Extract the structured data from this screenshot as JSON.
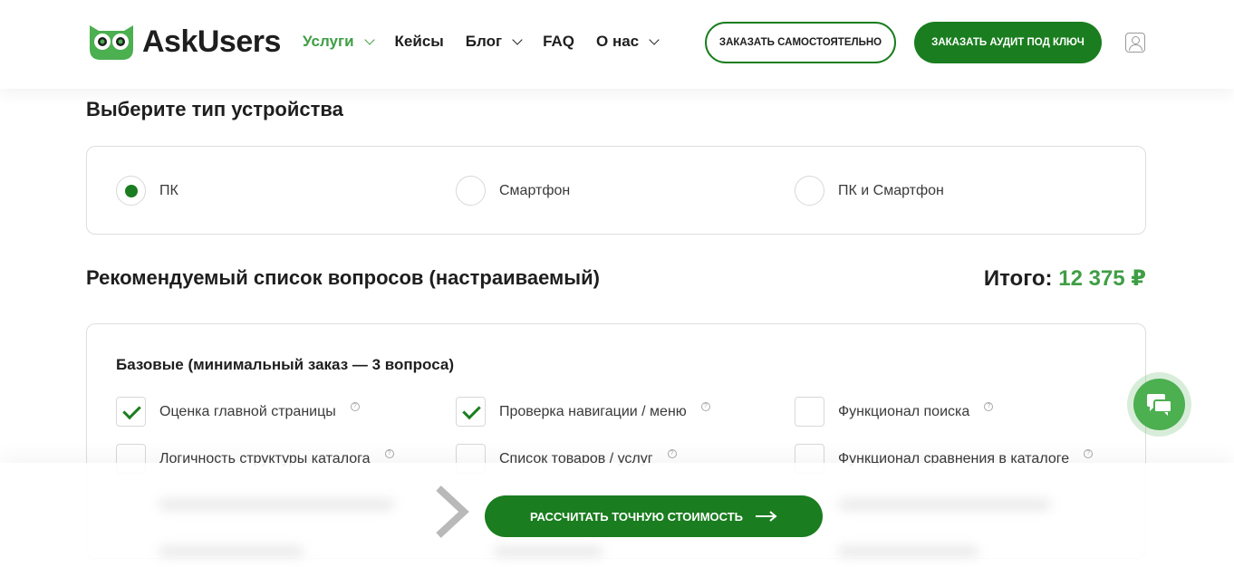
{
  "header": {
    "logo_text": "AskUsers",
    "nav": [
      {
        "label": "Услуги",
        "has_dropdown": true,
        "active": true
      },
      {
        "label": "Кейсы",
        "has_dropdown": false
      },
      {
        "label": "Блог",
        "has_dropdown": true
      },
      {
        "label": "FAQ",
        "has_dropdown": false
      },
      {
        "label": "О нас",
        "has_dropdown": true
      }
    ],
    "btn_self": "ЗАКАЗАТЬ САМОСТОЯТЕЛЬНО",
    "btn_turnkey": "ЗАКАЗАТЬ АУДИТ ПОД КЛЮЧ"
  },
  "device": {
    "title": "Выберите тип устройства",
    "options": [
      {
        "label": "ПК",
        "selected": true
      },
      {
        "label": "Смартфон",
        "selected": false
      },
      {
        "label": "ПК и Смартфон",
        "selected": false
      }
    ]
  },
  "questions": {
    "title": "Рекомендуемый список вопросов (настраиваемый)",
    "total_label": "Итого:",
    "total_value": "12 375 ₽",
    "group_title": "Базовые (минимальный заказ — 3 вопроса)",
    "items": [
      {
        "label": "Оценка главной страницы",
        "checked": true
      },
      {
        "label": "Проверка навигации / меню",
        "checked": true
      },
      {
        "label": "Функционал поиска",
        "checked": false
      },
      {
        "label": "Логичность структуры каталога",
        "checked": false
      },
      {
        "label": "Список товаров / услуг",
        "checked": false
      },
      {
        "label": "Функционал сравнения в каталоге",
        "checked": false
      }
    ],
    "help_glyph": "?"
  },
  "footer": {
    "calc_button": "РАССЧИТАТЬ ТОЧНУЮ СТОИМОСТЬ"
  },
  "colors": {
    "brand_green": "#1a7d1f",
    "accent_green": "#3f9e45",
    "chat_green": "#4caf50"
  }
}
